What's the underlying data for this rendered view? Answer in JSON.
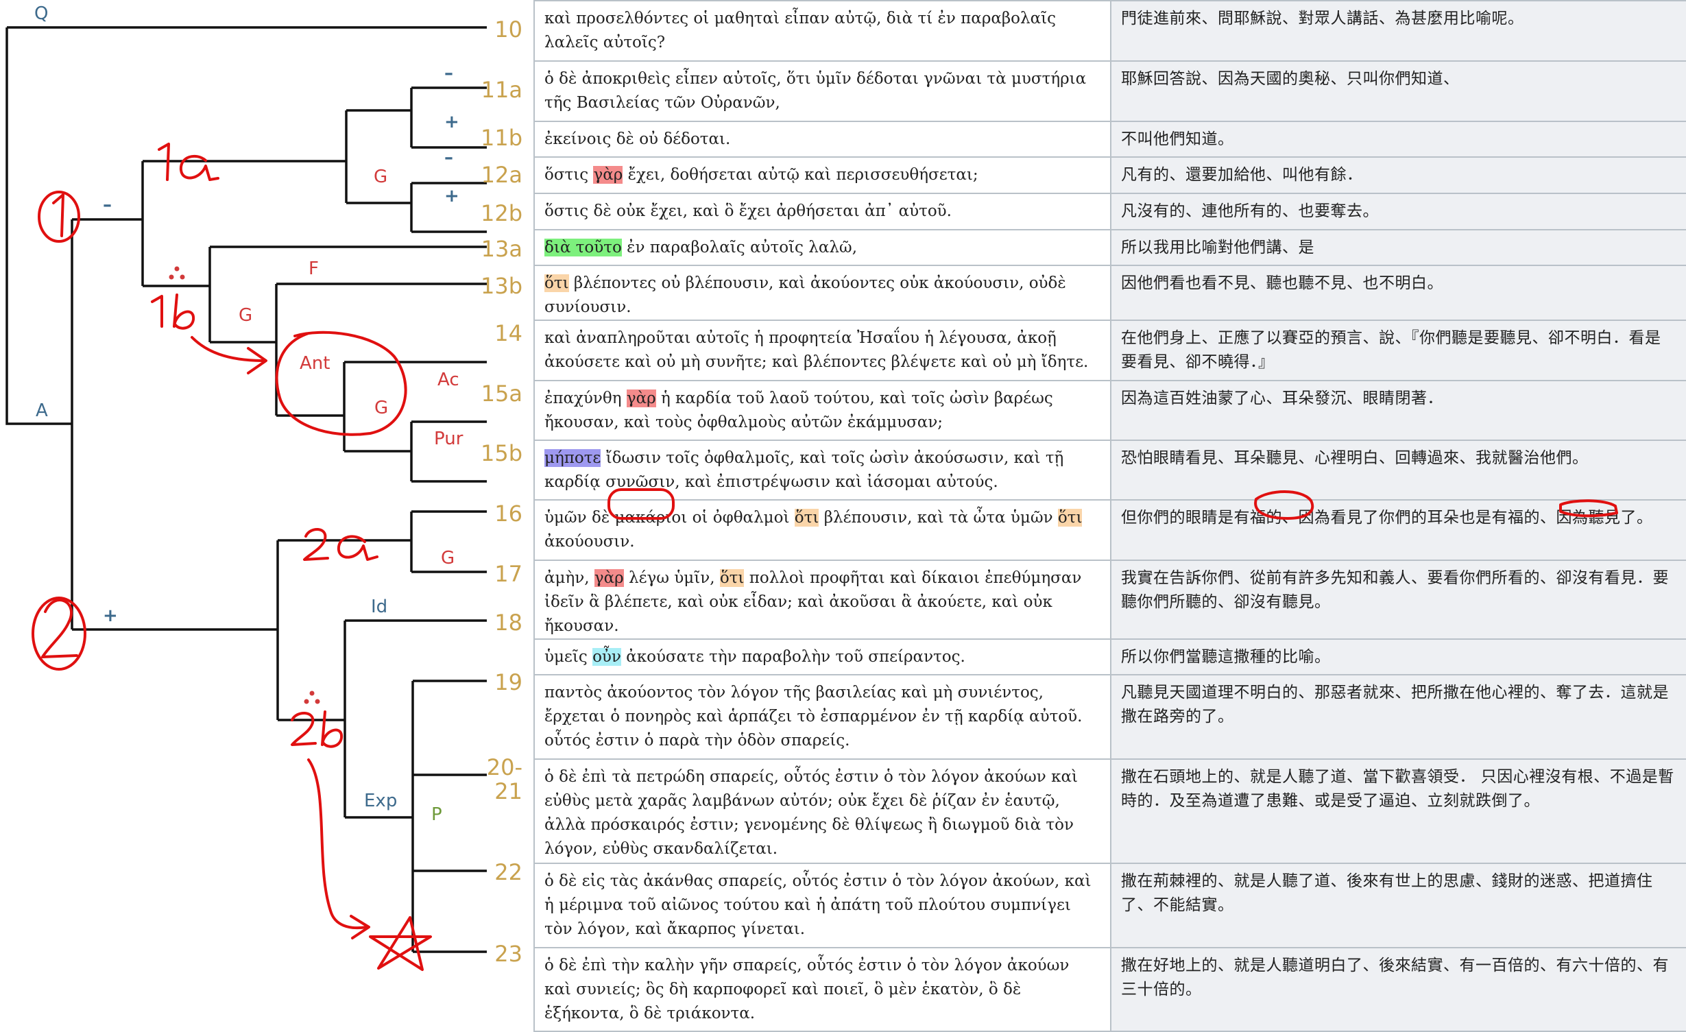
{
  "tree": {
    "node_labels": {
      "Q": "Q",
      "A": "A",
      "F": "F",
      "G": "G",
      "Ant": "Ant",
      "Ac": "Ac",
      "Pur": "Pur",
      "Id": "Id",
      "Exp": "Exp",
      "P": "P",
      "minus": "–",
      "plus": "+"
    },
    "handwriting": {
      "one": "①",
      "two": "②",
      "one_a": "1a",
      "one_b": "1b",
      "two_a": "2a",
      "two_b": "2b"
    }
  },
  "verses": [
    {
      "num": "10",
      "greek": [
        {
          "t": "καὶ προσελθόντες οἱ μαθηταὶ εἶπαν αὐτῷ, διὰ τί ἐν παραβολαῖς λαλεῖς αὐτοῖς?"
        }
      ],
      "chinese": "門徒進前來、問耶穌說、對眾人講話、為甚麼用比喻呢。"
    },
    {
      "num": "11a",
      "greek": [
        {
          "t": "ὁ δὲ ἀποκριθεὶς εἶπεν αὐτοῖς, ὅτι ὑμῖν δέδοται γνῶναι τὰ μυστήρια τῆς Βασιλείας τῶν Οὐρανῶν,"
        }
      ],
      "chinese": "耶穌回答說、因為天國的奧秘、只叫你們知道、"
    },
    {
      "num": "11b",
      "greek": [
        {
          "t": "ἐκείνοις δὲ οὐ δέδοται."
        }
      ],
      "chinese": "不叫他們知道。"
    },
    {
      "num": "12a",
      "greek": [
        {
          "t": "ὅστις "
        },
        {
          "t": "γὰρ",
          "hl": "red"
        },
        {
          "t": " ἔχει, δοθήσεται αὐτῷ καὶ περισσευθήσεται;"
        }
      ],
      "chinese": "凡有的、還要加給他、叫他有餘．"
    },
    {
      "num": "12b",
      "greek": [
        {
          "t": "ὅστις δὲ οὐκ ἔχει, καὶ ὃ ἔχει ἀρθήσεται ἀπ᾽ αὐτοῦ."
        }
      ],
      "chinese": "凡沒有的、連他所有的、也要奪去。"
    },
    {
      "num": "13a",
      "greek": [
        {
          "t": "διὰ τοῦτο",
          "hl": "green"
        },
        {
          "t": " ἐν παραβολαῖς αὐτοῖς λαλῶ,"
        }
      ],
      "chinese": "所以我用比喻對他們講、是"
    },
    {
      "num": "13b",
      "greek": [
        {
          "t": "ὅτι",
          "hl": "orange"
        },
        {
          "t": " βλέποντες οὐ βλέπουσιν, καὶ ἀκούοντες οὐκ ἀκούουσιν, οὐδὲ συνίουσιν."
        }
      ],
      "chinese": "因他們看也看不見、聽也聽不見、也不明白。"
    },
    {
      "num": "14",
      "greek": [
        {
          "t": "καὶ ἀναπληροῦται αὐτοῖς ἡ προφητεία Ἠσαΐου ἡ λέγουσα, ἀκοῇ ἀκούσετε καὶ οὐ μὴ συνῆτε; καὶ βλέποντες βλέψετε καὶ οὐ μὴ ἴδητε."
        }
      ],
      "chinese": "在他們身上、正應了以賽亞的預言、說、『你們聽是要聽見、卻不明白．看是要看見、卻不曉得．』"
    },
    {
      "num": "15a",
      "greek": [
        {
          "t": "ἐπαχύνθη "
        },
        {
          "t": "γὰρ",
          "hl": "red"
        },
        {
          "t": " ἡ καρδία τοῦ λαοῦ τούτου, καὶ τοῖς ὠσὶν βαρέως ἤκουσαν, καὶ τοὺς ὀφθαλμοὺς αὐτῶν ἐκάμμυσαν;"
        }
      ],
      "chinese": "因為這百姓油蒙了心、耳朵發沉、眼睛閉著．"
    },
    {
      "num": "15b",
      "greek": [
        {
          "t": "μήποτε",
          "hl": "purple"
        },
        {
          "t": " ἴδωσιν τοῖς ὀφθαλμοῖς, καὶ τοῖς ὠσὶν ἀκούσωσιν, καὶ τῇ καρδίᾳ συνῶσιν, καὶ ἐπιστρέψωσιν καὶ ἰάσομαι αὐτούς."
        }
      ],
      "chinese": "恐怕眼睛看見、耳朵聽見、心裡明白、回轉過來、我就醫治他們。"
    },
    {
      "num": "16",
      "greek": [
        {
          "t": "ὑμῶν δὲ μακάριοι οἱ ὀφθαλμοὶ "
        },
        {
          "t": "ὅτι",
          "hl": "orange"
        },
        {
          "t": " βλέπουσιν, καὶ τὰ ὦτα ὑμῶν "
        },
        {
          "t": "ὅτι",
          "hl": "orange"
        },
        {
          "t": " ἀκούουσιν."
        }
      ],
      "chinese": "但你們的眼睛是有福的、因為看見了你們的耳朵也是有福的、因為聽見了。"
    },
    {
      "num": "17",
      "greek": [
        {
          "t": "ἀμὴν, "
        },
        {
          "t": "γὰρ",
          "hl": "red"
        },
        {
          "t": " λέγω ὑμῖν, "
        },
        {
          "t": "ὅτι",
          "hl": "orange"
        },
        {
          "t": " πολλοὶ προφῆται καὶ δίκαιοι ἐπεθύμησαν ἰδεῖν ἃ βλέπετε, καὶ οὐκ εἶδαν; καὶ ἀκοῦσαι ἃ ἀκούετε, καὶ οὐκ ἤκουσαν."
        }
      ],
      "chinese": "我實在告訴你們、從前有許多先知和義人、要看你們所看的、卻沒有看見．要聽你們所聽的、卻沒有聽見。"
    },
    {
      "num": "18",
      "greek": [
        {
          "t": "ὑμεῖς "
        },
        {
          "t": "οὖν",
          "hl": "cyan"
        },
        {
          "t": " ἀκούσατε τὴν παραβολὴν τοῦ σπείραντος."
        }
      ],
      "chinese": "所以你們當聽這撒種的比喻。"
    },
    {
      "num": "19",
      "greek": [
        {
          "t": "παντὸς ἀκούοντος τὸν λόγον τῆς βασιλείας καὶ μὴ συνιέντος, ἔρχεται ὁ πονηρὸς καὶ ἁρπάζει τὸ ἐσπαρμένον ἐν τῇ καρδίᾳ αὐτοῦ. οὗτός ἐστιν ὁ παρὰ τὴν ὁδὸν σπαρείς."
        }
      ],
      "chinese": "凡聽見天國道理不明白的、那惡者就來、把所撒在他心裡的、奪了去．這就是撒在路旁的了。"
    },
    {
      "num": "20-21",
      "greek": [
        {
          "t": "ὁ δὲ ἐπὶ τὰ πετρώδη σπαρείς, οὗτός ἐστιν ὁ τὸν λόγον ἀκούων καὶ εὐθὺς μετὰ χαρᾶς λαμβάνων αὐτόν; οὐκ ἔχει δὲ ῥίζαν ἐν ἑαυτῷ, ἀλλὰ πρόσκαιρός ἐστιν; γενομένης δὲ θλίψεως ἢ διωγμοῦ διὰ τὸν λόγον, εὐθὺς σκανδαλίζεται."
        }
      ],
      "chinese": "撒在石頭地上的、就是人聽了道、當下歡喜領受． 只因心裡沒有根、不過是暫時的．及至為道遭了患難、或是受了逼迫、立刻就跌倒了。"
    },
    {
      "num": "22",
      "greek": [
        {
          "t": "ὁ δὲ εἰς τὰς ἀκάνθας σπαρείς, οὗτός ἐστιν ὁ τὸν λόγον ἀκούων, καὶ ἡ μέριμνα τοῦ αἰῶνος τούτου καὶ ἡ ἀπάτη τοῦ πλούτου συμπνίγει τὸν λόγον, καὶ ἄκαρπος γίνεται."
        }
      ],
      "chinese": "撒在荊棘裡的、就是人聽了道、後來有世上的思慮、錢財的迷惑、把道擠住了、不能結實。"
    },
    {
      "num": "23",
      "greek": [
        {
          "t": "ὁ δὲ ἐπὶ τὴν καλὴν γῆν σπαρείς, οὗτός ἐστιν ὁ τὸν λόγον ἀκούων καὶ συνιείς; ὃς δὴ καρποφορεῖ καὶ ποιεῖ, ὃ μὲν ἑκατὸν, ὃ δὲ ἑξήκοντα, ὃ δὲ τριάκοντα."
        }
      ],
      "chinese": "撒在好地上的、就是人聽道明白了、後來結實、有一百倍的、有六十倍的、有三十倍的。"
    }
  ]
}
